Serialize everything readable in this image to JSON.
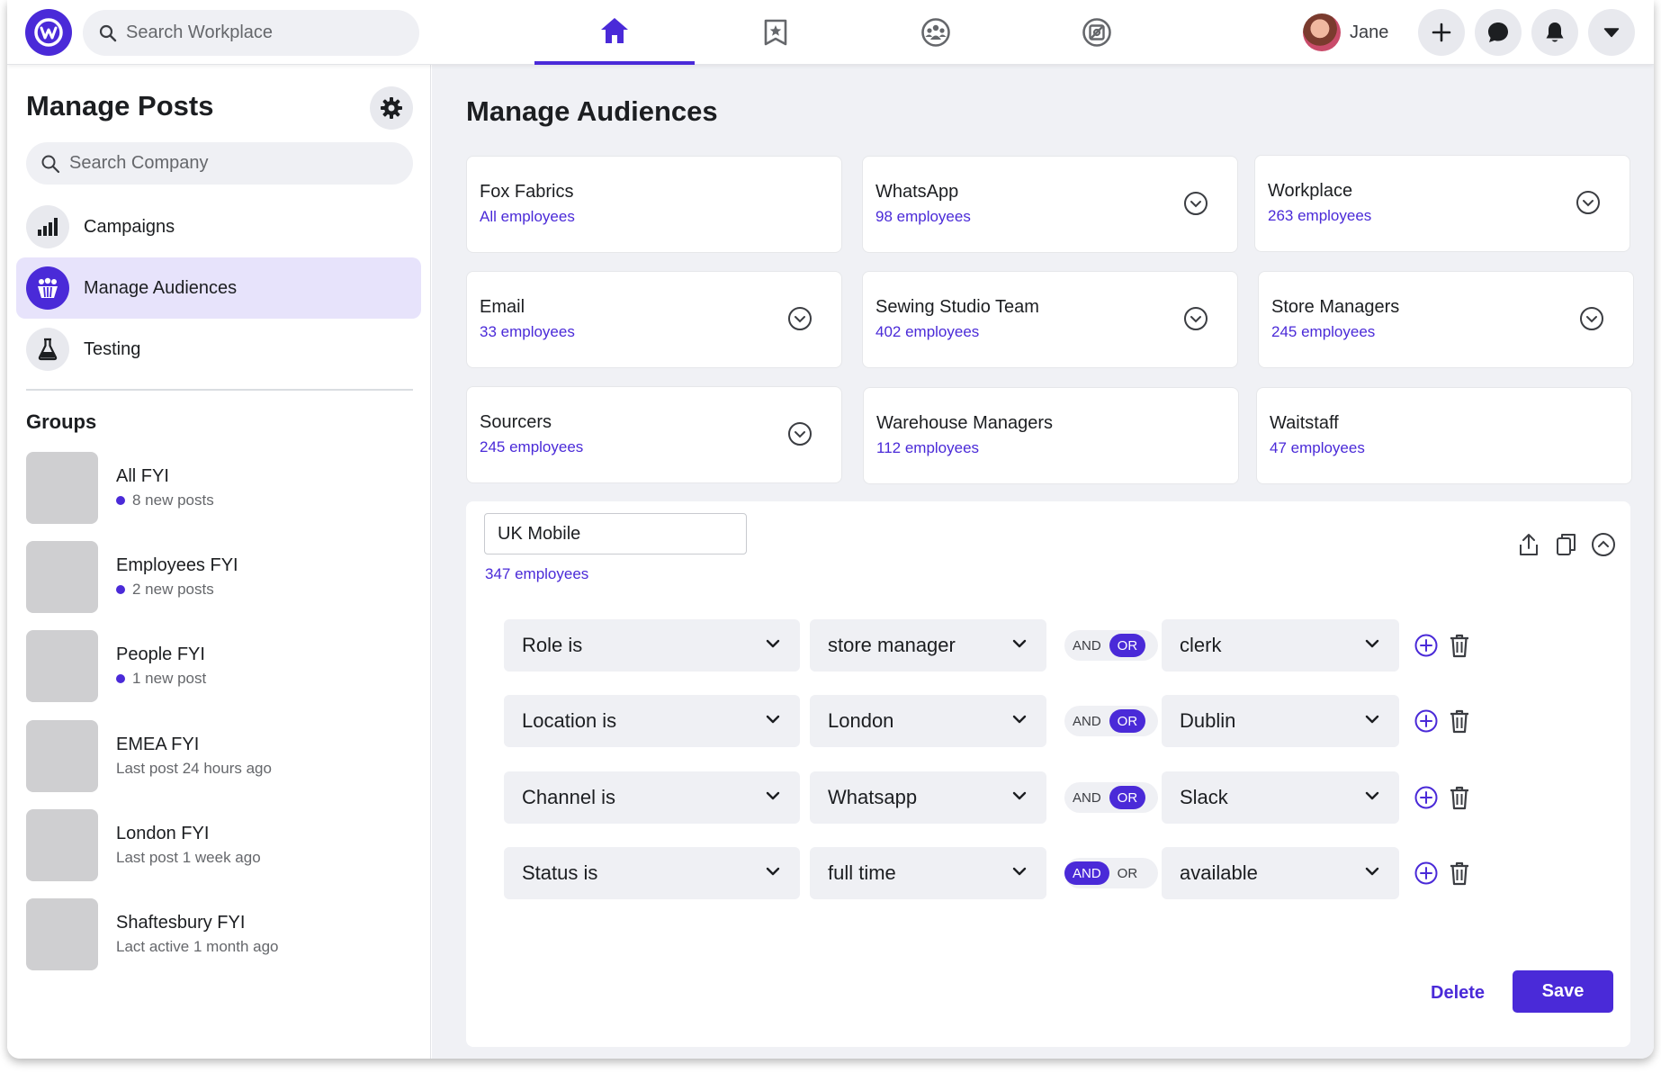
{
  "colors": {
    "accent": "#4a2ad8",
    "background": "#f0f1f5",
    "selected_item": "#e7e3fb"
  },
  "topbar": {
    "search_placeholder": "Search Workplace",
    "nav": [
      {
        "icon": "home-icon",
        "active": true
      },
      {
        "icon": "bookmark-star-icon",
        "active": false
      },
      {
        "icon": "groups-icon",
        "active": false
      },
      {
        "icon": "compass-icon",
        "active": false
      }
    ],
    "user_name": "Jane"
  },
  "sidebar": {
    "title": "Manage Posts",
    "search_placeholder": "Search Company",
    "items": [
      {
        "label": "Campaigns",
        "icon": "bar-chart-icon"
      },
      {
        "label": "Manage Audiences",
        "icon": "audience-icon",
        "active": true
      },
      {
        "label": "Testing",
        "icon": "flask-icon"
      }
    ],
    "groups_title": "Groups",
    "groups": [
      {
        "name": "All FYI",
        "sub": "8 new posts",
        "new": true
      },
      {
        "name": "Employees FYI",
        "sub": "2 new posts",
        "new": true
      },
      {
        "name": "People FYI",
        "sub": "1 new post",
        "new": true
      },
      {
        "name": "EMEA FYI",
        "sub": "Last post 24 hours ago",
        "new": false
      },
      {
        "name": "London FYI",
        "sub": "Last post 1 week ago",
        "new": false
      },
      {
        "name": "Shaftesbury FYI",
        "sub": "Lact active 1 month ago",
        "new": false
      }
    ]
  },
  "main": {
    "title": "Manage Audiences",
    "audiences": [
      {
        "name": "Fox Fabrics",
        "count": "All employees",
        "chevron": false
      },
      {
        "name": "WhatsApp",
        "count": "98 employees",
        "chevron": true
      },
      {
        "name": "Workplace",
        "count": "263 employees",
        "chevron": true
      },
      {
        "name": "Email",
        "count": "33 employees",
        "chevron": true
      },
      {
        "name": "Sewing Studio Team",
        "count": "402 employees",
        "chevron": true
      },
      {
        "name": "Store Managers",
        "count": "245 employees",
        "chevron": true
      },
      {
        "name": "Sourcers",
        "count": "245 employees",
        "chevron": true
      },
      {
        "name": "Warehouse Managers",
        "count": "112 employees",
        "chevron": false
      },
      {
        "name": "Waitstaff",
        "count": "47 employees",
        "chevron": false
      }
    ],
    "editor": {
      "name_value": "UK Mobile",
      "count": "347 employees",
      "rules": [
        {
          "field": "Role is",
          "value1": "store manager",
          "and": "AND",
          "or": "OR",
          "selected": "OR",
          "value2": "clerk"
        },
        {
          "field": "Location is",
          "value1": "London",
          "and": "AND",
          "or": "OR",
          "selected": "OR",
          "value2": "Dublin"
        },
        {
          "field": "Channel is",
          "value1": "Whatsapp",
          "and": "AND",
          "or": "OR",
          "selected": "OR",
          "value2": "Slack"
        },
        {
          "field": "Status is",
          "value1": "full time",
          "and": "AND",
          "or": "OR",
          "selected": "AND",
          "value2": "available"
        }
      ],
      "delete_label": "Delete",
      "save_label": "Save"
    }
  }
}
